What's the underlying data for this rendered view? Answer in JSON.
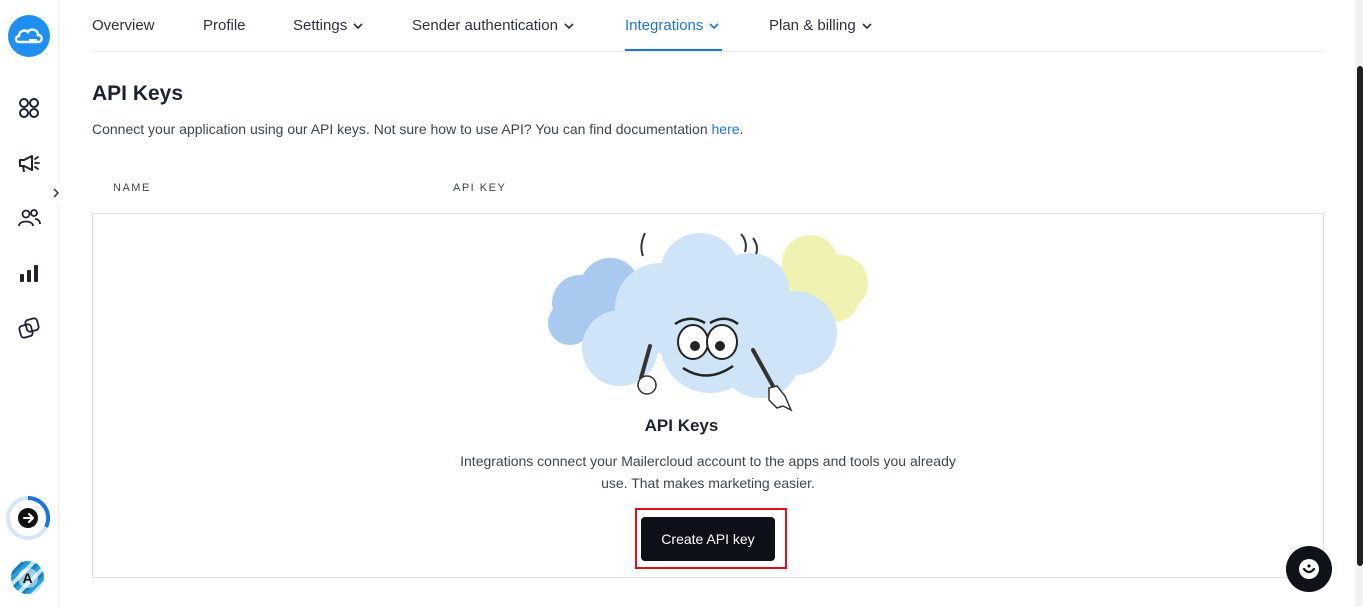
{
  "sidebar": {
    "items": [
      {
        "name": "dashboard",
        "icon": "grid-icon"
      },
      {
        "name": "campaigns",
        "icon": "megaphone-icon"
      },
      {
        "name": "audience",
        "icon": "users-icon"
      },
      {
        "name": "reports",
        "icon": "bar-chart-icon"
      },
      {
        "name": "automation",
        "icon": "automation-icon"
      }
    ],
    "avatar_initial": "A",
    "setup_progress": 0.35
  },
  "tabs": [
    {
      "label": "Overview",
      "dropdown": false
    },
    {
      "label": "Profile",
      "dropdown": false
    },
    {
      "label": "Settings",
      "dropdown": true
    },
    {
      "label": "Sender authentication",
      "dropdown": true
    },
    {
      "label": "Integrations",
      "dropdown": true,
      "active": true
    },
    {
      "label": "Plan & billing",
      "dropdown": true
    }
  ],
  "page": {
    "title": "API Keys",
    "description": "Connect your application using our API keys. Not sure how to use API? You can find documentation ",
    "description_link": "here",
    "description_end": "."
  },
  "table": {
    "columns": [
      "NAME",
      "API KEY"
    ]
  },
  "empty_state": {
    "title": "API Keys",
    "text": "Integrations connect your Mailercloud account to the apps and tools you already use. That makes marketing easier.",
    "button_label": "Create API key"
  },
  "colors": {
    "accent": "#1e74d9",
    "button_bg": "#0d1018",
    "highlight": "#e0101b"
  }
}
